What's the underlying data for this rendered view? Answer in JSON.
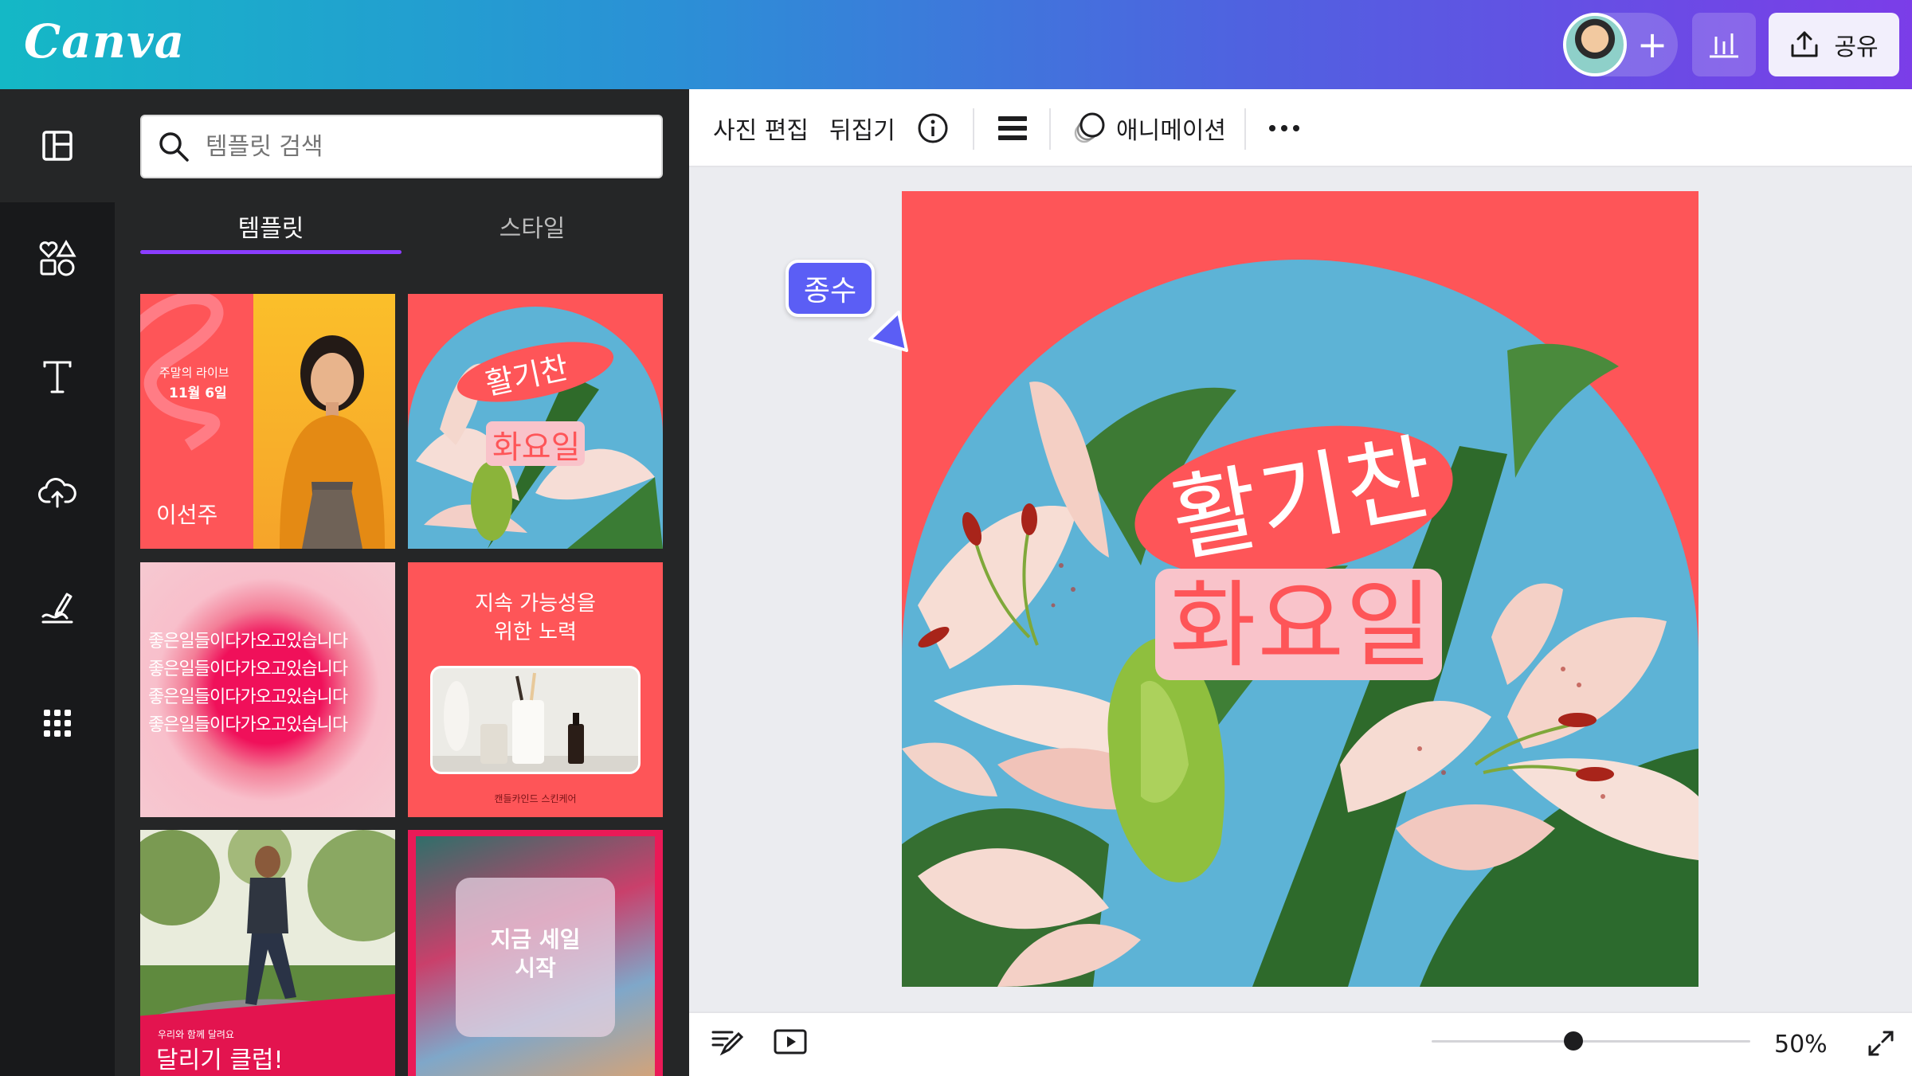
{
  "app": {
    "logo": "Canva"
  },
  "header": {
    "share_label": "공유"
  },
  "search": {
    "placeholder": "템플릿 검색"
  },
  "panel": {
    "tabs": [
      {
        "label": "템플릿"
      },
      {
        "label": "스타일"
      }
    ],
    "templates": [
      {
        "small": "주말의 라이브",
        "date": "11월 6일",
        "name": "이선주"
      },
      {
        "line1": "활기찬",
        "line2": "화요일"
      },
      {
        "repeat_text": "좋은일들이다가오고있습니다\n좋은일들이다가오고있습니다\n좋은일들이다가오고있습니다\n좋은일들이다가오고있습니다"
      },
      {
        "title": "지속 가능성을\n위한 노력",
        "footer": "캔들카인드 스킨케어"
      },
      {
        "small": "우리와 함께 달려요",
        "title": "달리기 클럽!"
      },
      {
        "title": "지금 세일\n시작"
      }
    ]
  },
  "toolbar": {
    "edit_photo": "사진 편집",
    "flip": "뒤집기",
    "animate": "애니메이션"
  },
  "canvas": {
    "collaborator_name": "종수",
    "headline_line1": "활기찬",
    "headline_line2": "화요일"
  },
  "footer": {
    "zoom": "50%",
    "zoom_level": 0.5
  },
  "colors": {
    "brand_purple": "#8b3dff",
    "design_red": "#fe5558",
    "collaborator": "#5b5ef5",
    "sky": "#5db3d6"
  }
}
